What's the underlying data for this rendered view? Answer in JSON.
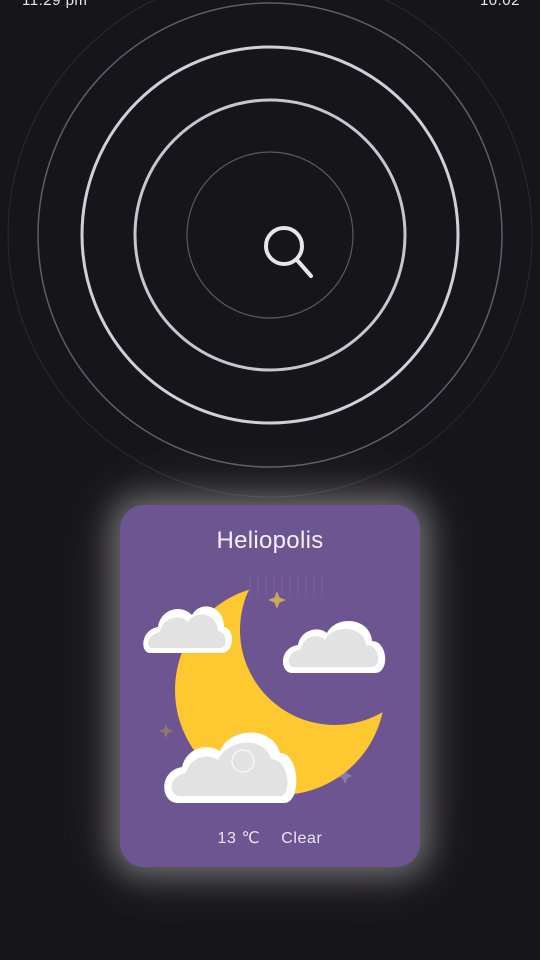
{
  "status_bar": {
    "time": "11:29 pm",
    "right": "10:02"
  },
  "search": {
    "icon": "search-icon"
  },
  "weather_card": {
    "city": "Heliopolis",
    "temperature": "13 ℃",
    "condition": "Clear",
    "illustration": "crescent-moon-with-clouds-icon",
    "colors": {
      "card": "#6c5591",
      "moon": "#fdc830",
      "cloud": "#e4e4e4"
    }
  }
}
